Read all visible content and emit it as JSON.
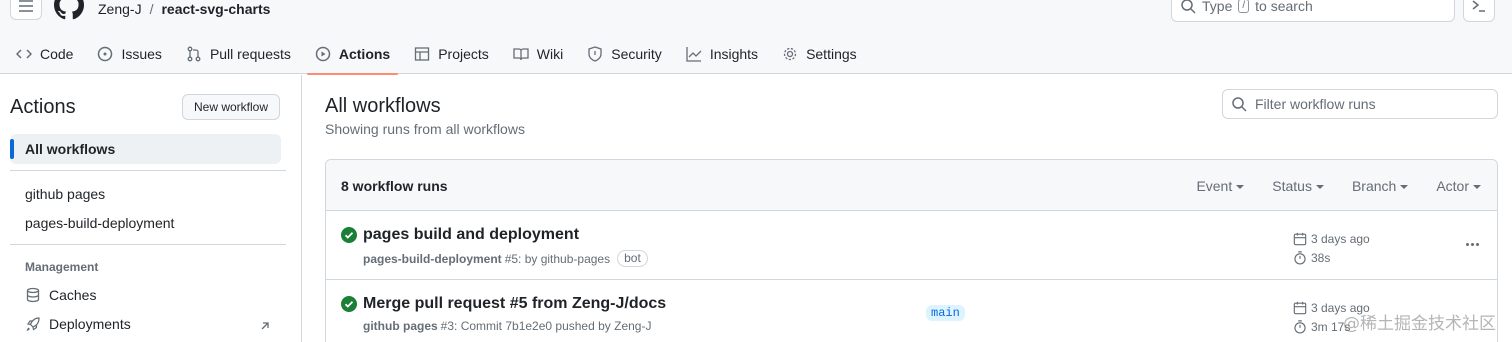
{
  "header": {
    "owner": "Zeng-J",
    "separator": "/",
    "repo": "react-svg-charts",
    "search_prefix": "Type",
    "search_key": "/",
    "search_suffix": "to search"
  },
  "tabs": [
    {
      "label": "Code",
      "icon": "code-icon"
    },
    {
      "label": "Issues",
      "icon": "issue-icon"
    },
    {
      "label": "Pull requests",
      "icon": "pull-request-icon"
    },
    {
      "label": "Actions",
      "icon": "play-icon",
      "active": true
    },
    {
      "label": "Projects",
      "icon": "table-icon"
    },
    {
      "label": "Wiki",
      "icon": "book-icon"
    },
    {
      "label": "Security",
      "icon": "shield-icon"
    },
    {
      "label": "Insights",
      "icon": "graph-icon"
    },
    {
      "label": "Settings",
      "icon": "gear-icon"
    }
  ],
  "sidebar": {
    "title": "Actions",
    "new_workflow": "New workflow",
    "all_workflows": "All workflows",
    "workflows": [
      "github pages",
      "pages-build-deployment"
    ],
    "management_heading": "Management",
    "management": [
      {
        "label": "Caches",
        "icon": "database-icon"
      },
      {
        "label": "Deployments",
        "icon": "rocket-icon"
      }
    ]
  },
  "main": {
    "title": "All workflows",
    "subtitle": "Showing runs from all workflows",
    "filter_placeholder": "Filter workflow runs",
    "run_count": "8 workflow runs",
    "filters": [
      "Event",
      "Status",
      "Branch",
      "Actor"
    ],
    "runs": [
      {
        "title": "pages build and deployment",
        "workflow": "pages-build-deployment",
        "detail": "#5: by github-pages",
        "badge": "bot",
        "branch": "",
        "when": "3 days ago",
        "duration": "38s"
      },
      {
        "title": "Merge pull request #5 from Zeng-J/docs",
        "workflow": "github pages",
        "detail": "#3: Commit 7b1e2e0 pushed by Zeng-J",
        "badge": "",
        "branch": "main",
        "when": "3 days ago",
        "duration": "3m 17s"
      }
    ]
  },
  "watermark": "@稀土掘金技术社区",
  "colors": {
    "accent": "#fd8c73",
    "success": "#1a7f37",
    "link": "#0969da"
  }
}
